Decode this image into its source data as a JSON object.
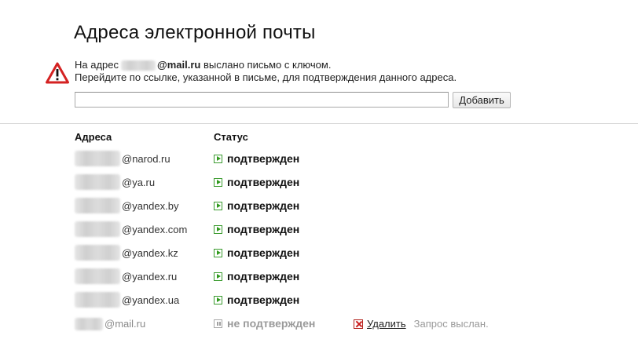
{
  "page": {
    "title": "Адреса электронной почты"
  },
  "notice": {
    "prefix": "На адрес",
    "email_domain": "@mail.ru",
    "suffix": "выслано письмо с ключом.",
    "line2": "Перейдите по ссылке, указанной в письме, для подтверждения данного адреса."
  },
  "form": {
    "input_value": "",
    "add_label": "Добавить"
  },
  "table": {
    "headers": {
      "address": "Адреса",
      "status": "Статус"
    },
    "rows": [
      {
        "domain": "@narod.ru",
        "status": "подтвержден",
        "confirmed": true
      },
      {
        "domain": "@ya.ru",
        "status": "подтвержден",
        "confirmed": true
      },
      {
        "domain": "@yandex.by",
        "status": "подтвержден",
        "confirmed": true
      },
      {
        "domain": "@yandex.com",
        "status": "подтвержден",
        "confirmed": true
      },
      {
        "domain": "@yandex.kz",
        "status": "подтвержден",
        "confirmed": true
      },
      {
        "domain": "@yandex.ru",
        "status": "подтвержден",
        "confirmed": true
      },
      {
        "domain": "@yandex.ua",
        "status": "подтвержден",
        "confirmed": true
      },
      {
        "domain": "@mail.ru",
        "status": "не подтвержден",
        "confirmed": false,
        "delete_label": "Удалить",
        "note": "Запрос выслан."
      }
    ]
  },
  "colors": {
    "confirmed": "#2f9a1c",
    "delete": "#cc1e1e",
    "pending": "#9a9a9a"
  },
  "icons": {
    "warning": "warning-triangle-icon",
    "confirmed": "play-icon",
    "pending": "pause-icon",
    "delete": "close-icon"
  }
}
